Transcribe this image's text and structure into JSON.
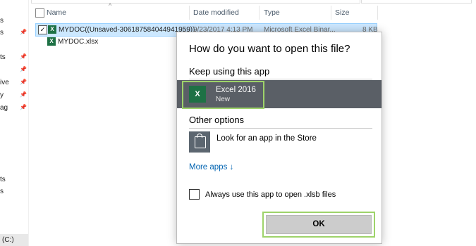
{
  "nav": {
    "items": [
      {
        "label": "s",
        "pinned": false
      },
      {
        "label": "s",
        "pinned": true
      },
      {
        "label": "ts",
        "pinned": true
      },
      {
        "label": "",
        "pinned": true
      },
      {
        "label": "ive",
        "pinned": true
      },
      {
        "label": "y",
        "pinned": true
      },
      {
        "label": "ag",
        "pinned": true
      },
      {
        "label": "ts",
        "pinned": false
      },
      {
        "label": "s",
        "pinned": false
      }
    ],
    "drive_label": "(C:)"
  },
  "list": {
    "columns": [
      "Name",
      "Date modified",
      "Type",
      "Size"
    ],
    "rows": [
      {
        "name": "MYDOC((Unsaved-306187584044941959))",
        "date": "9/23/2017 4:13 PM",
        "type": "Microsoft Excel Binar...",
        "size": "8 KB",
        "selected": true,
        "checked": true
      },
      {
        "name": "MYDOC.xlsx",
        "date": "",
        "type": "",
        "size": "",
        "selected": false,
        "checked": false
      }
    ]
  },
  "dialog": {
    "title": "How do you want to open this file?",
    "keep_using_heading": "Keep using this app",
    "current_app": {
      "name": "Excel 2016",
      "sub": "New",
      "icon": "excel-icon"
    },
    "other_options_heading": "Other options",
    "store_option": {
      "label": "Look for an app in the Store",
      "icon": "store-icon"
    },
    "more_apps": "More apps ↓",
    "always_use": "Always use this app to open .xlsb files",
    "always_checked": false,
    "ok_label": "OK"
  },
  "colors": {
    "accent_focus": "#9ed36a",
    "selected_app_bg": "#5a5f66",
    "link": "#0063b1",
    "row_selected": "#cce8ff",
    "excel_green": "#1e7145"
  }
}
